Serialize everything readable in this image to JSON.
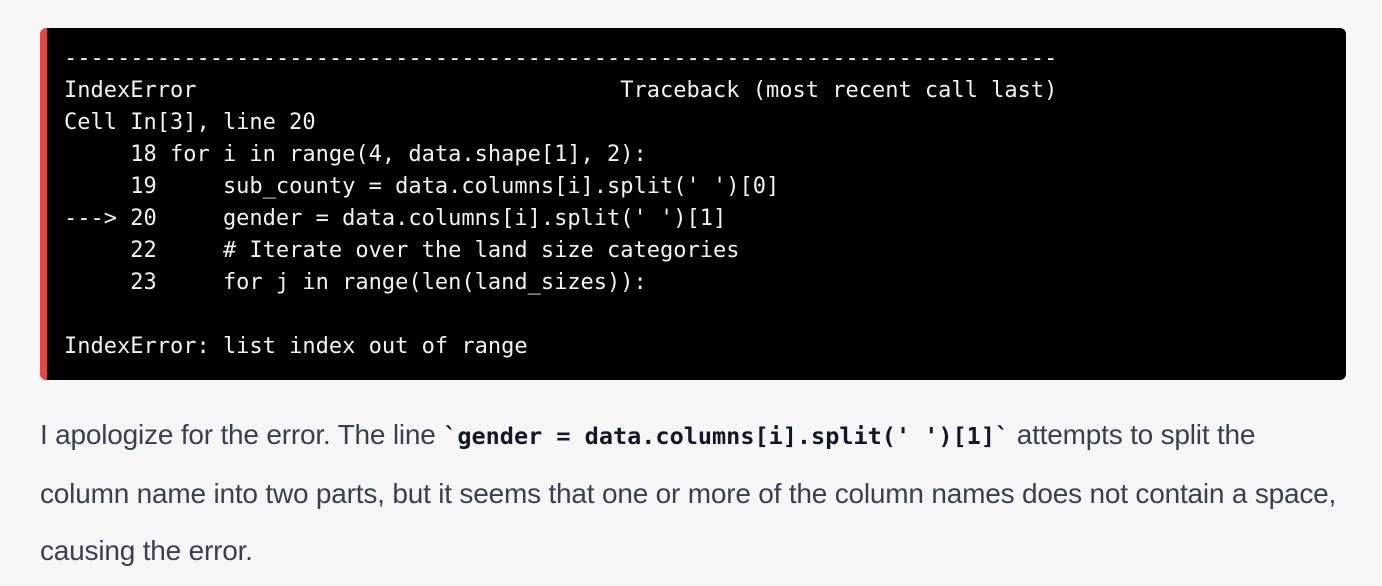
{
  "traceback": {
    "lines": [
      "---------------------------------------------------------------------------",
      "IndexError                                Traceback (most recent call last)",
      "Cell In[3], line 20",
      "     18 for i in range(4, data.shape[1], 2):",
      "     19     sub_county = data.columns[i].split(' ')[0]",
      "---> 20     gender = data.columns[i].split(' ')[1]",
      "     22     # Iterate over the land size categories",
      "     23     for j in range(len(land_sizes)):",
      "",
      "IndexError: list index out of range"
    ]
  },
  "response": {
    "text_before": "I apologize for the error. The line ",
    "inline_code": "`gender = data.columns[i].split(' ')[1]`",
    "text_after": " attempts to split the column name into two parts, but it seems that one or more of the column names does not contain a space, causing the error."
  },
  "colors": {
    "error_accent": "#e04848",
    "code_background": "#000000",
    "page_background": "#f7f7f8"
  }
}
